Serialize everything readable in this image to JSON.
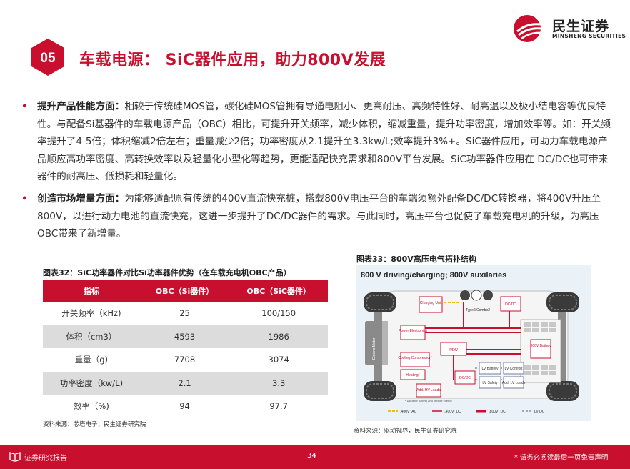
{
  "header": {
    "logo_name": "民生证券",
    "logo_en": "MINSHENG SECURITIES",
    "section_number": "05",
    "title": "车载电源： SiC器件应用，助力800V发展"
  },
  "paragraphs": [
    {
      "bold": "提升产品性能方面：",
      "text": "相较于传统硅MOS管，碳化硅MOS管拥有导通电阻小、更高耐压、高频特性好、耐高温以及极小结电容等优良特性。与配备Si基器件的车载电源产品（OBC）相比，可提升开关频率，减少体积，缩减重量，提升功率密度，增加效率等。如：开关频率提升了4-5倍；体积缩减2倍左右；重量减少2倍；功率密度从2.1提升至3.3kw/L;效率提升3%+。SiC器件应用，可助力车载电源产品顺应高功率密度、高转换效率以及轻量化小型化等趋势，更能适配快充需求和800V平台发展。SiC功率器件应用在 DC/DC也可带来器件的耐高压、低损耗和轻量化。"
    },
    {
      "bold": "创造市场增量方面：",
      "text": "为能够适配原有传统的400V直流快充桩，搭载800V电压平台的车端须额外配备DC/DC转换器，将400V升压至800V，以进行动力电池的直流快充，这进一步提升了DC/DC器件的需求。与此同时，高压平台也促使了车载充电机的升级，为高压OBC带来了新增量。"
    }
  ],
  "table": {
    "caption": "图表32：SiC功率器件对比Si功率器件优势（在车载充电机OBC产品）",
    "headers": [
      "指标",
      "OBC（Si器件）",
      "OBC（SiC器件）"
    ],
    "rows": [
      [
        "开关频率（kHz)",
        "25",
        "100/150"
      ],
      [
        "体积（cm3）",
        "4593",
        "1986"
      ],
      [
        "重量（g)",
        "7708",
        "3074"
      ],
      [
        "功率密度（kw/L)",
        "2.1",
        "3.3"
      ],
      [
        "效率（%)",
        "94",
        "97.7"
      ]
    ],
    "source": "资料来源：芯塔电子，民生证券研究院"
  },
  "diagram": {
    "caption": "图表33：800V高压电气拓扑结构",
    "heading": "800 V driving/charging; 800V auxilaries",
    "labels": {
      "charging_unit": "Charging Unit",
      "connector": "Type2/Combo2",
      "dcdc_top": "DC/DC",
      "battery": "800V Battery",
      "motor": "Electric Motor",
      "power_electronics": "Power Electronics",
      "pdu": "PDU",
      "cooling": "Cooling Compressor*",
      "heating": "Heating*",
      "dcdc_mid": "DC/DC",
      "lv_battery": "LV Battery",
      "lv_comfort": "LV Comfort",
      "lv_safety": "LV Safety",
      "add_lv": "Add. LV Loads",
      "add_hv": "Add. HV Loads",
      "footnote": "* Used for battery and vehicle interior",
      "legend_ac": "„400V\" AC",
      "legend_dc400": "„400V\" DC",
      "legend_dc800": "„800V\" DC",
      "legend_lv": "LV DC"
    },
    "source": "资料来源：驱动视界，民生证券研究院"
  },
  "footer": {
    "left": "证券研究报告",
    "page": "34",
    "right": "* 请务必阅读最后一页免责声明"
  },
  "colors": {
    "brand_red": "#c8102e",
    "row_alt": "#dcdcdc"
  }
}
